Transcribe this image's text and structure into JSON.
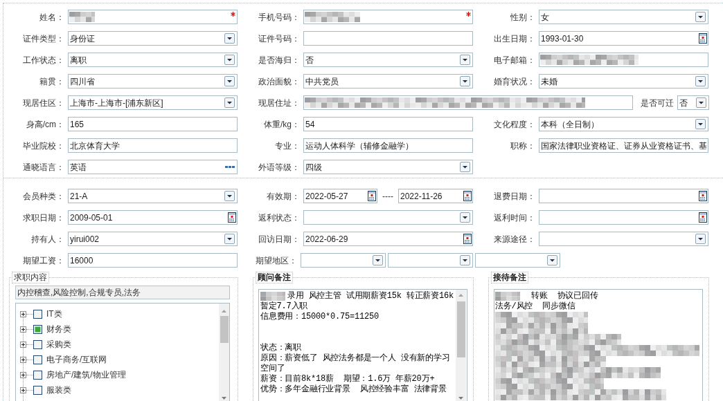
{
  "profile": {
    "rows": [
      [
        {
          "label": "姓名：",
          "kind": "text",
          "required": true,
          "redacted": true
        },
        {
          "label": "手机号码：",
          "kind": "text",
          "required": true,
          "redacted": true
        },
        {
          "label": "性别：",
          "kind": "select",
          "value": "女",
          "required": false,
          "redacted": false
        }
      ],
      [
        {
          "label": "证件类型：",
          "kind": "select",
          "value": "身份证",
          "required": false,
          "redacted": false
        },
        {
          "label": "证件号码：",
          "kind": "text",
          "required": false,
          "redacted": false
        },
        {
          "label": "出生日期：",
          "kind": "date",
          "value": "1993-01-30",
          "required": false,
          "redacted": false
        }
      ],
      [
        {
          "label": "工作状态：",
          "kind": "select",
          "value": "离职",
          "required": false,
          "redacted": false
        },
        {
          "label": "是否海归：",
          "kind": "select",
          "value": "否",
          "required": false,
          "redacted": false
        },
        {
          "label": "电子邮箱：",
          "kind": "text",
          "required": false,
          "redacted": true
        }
      ],
      [
        {
          "label": "籍贯：",
          "kind": "select",
          "value": "四川省",
          "required": false,
          "redacted": false
        },
        {
          "label": "政治面貌：",
          "kind": "select",
          "value": "中共党员",
          "required": false,
          "redacted": false
        },
        {
          "label": "婚育状况：",
          "kind": "select",
          "value": "未婚",
          "required": false,
          "redacted": false
        }
      ],
      [
        {
          "label": "现居住区：",
          "kind": "select",
          "value": "上海市-上海市-[浦东新区]",
          "required": false,
          "redacted": false
        },
        {
          "label": "现居住址：",
          "kind": "wide_text",
          "required": false,
          "redacted": true
        },
        {
          "label": "是否可迁",
          "kind": "compact_select",
          "value": "否",
          "required": false,
          "redacted": false
        }
      ],
      [
        {
          "label": "身高/cm：",
          "kind": "text",
          "value": "165",
          "required": false,
          "redacted": false
        },
        {
          "label": "体重/kg：",
          "kind": "text",
          "value": "54",
          "required": false,
          "redacted": false
        },
        {
          "label": "文化程度：",
          "kind": "select",
          "value": "本科（全日制）",
          "required": false,
          "redacted": false
        }
      ],
      [
        {
          "label": "毕业院校：",
          "kind": "text",
          "value": "北京体育大学",
          "required": false,
          "redacted": false
        },
        {
          "label": "专业：",
          "kind": "text",
          "value": "运动人体科学（辅修金融学）",
          "required": false,
          "redacted": false
        },
        {
          "label": "职称：",
          "kind": "text",
          "value": "国家法律职业资格证、证券从业资格证书、基",
          "required": false,
          "redacted": false
        }
      ],
      [
        {
          "label": "通晓语言：",
          "kind": "lookup",
          "value": "英语",
          "required": false,
          "redacted": false
        },
        {
          "label": "外语等级：",
          "kind": "select",
          "value": "四级",
          "required": false,
          "redacted": false
        }
      ]
    ]
  },
  "membership": {
    "rows": [
      [
        {
          "label": "会员种类：",
          "kind": "select",
          "value": "21-A",
          "required": false,
          "redacted": false
        },
        {
          "label": "有效期：",
          "kind": "date_range",
          "values": [
            "2022-05-27",
            "2022-11-26"
          ],
          "separator": "----",
          "required": false,
          "redacted": false
        },
        {
          "label": "退费日期：",
          "kind": "date",
          "required": false,
          "redacted": false
        }
      ],
      [
        {
          "label": "求职日期：",
          "kind": "date",
          "value": "2009-05-01",
          "required": false,
          "redacted": false
        },
        {
          "label": "返利状态：",
          "kind": "select",
          "required": false,
          "redacted": false
        },
        {
          "label": "返利时间：",
          "kind": "date",
          "required": false,
          "redacted": false
        }
      ],
      [
        {
          "label": "持有人：",
          "kind": "select",
          "value": "yirui002",
          "required": false,
          "redacted": false
        },
        {
          "label": "回访日期：",
          "kind": "date",
          "value": "2022-06-29",
          "required": false,
          "redacted": false
        },
        {
          "label": "来源途径：",
          "kind": "select",
          "required": false,
          "redacted": false
        }
      ],
      [
        {
          "label": "期望工资：",
          "kind": "text",
          "value": "16000",
          "required": false,
          "redacted": false
        },
        {
          "label": "期望地区：",
          "kind": "select_group",
          "selects": [
            {
              "kind": "select"
            },
            {
              "kind": "select"
            },
            {
              "kind": "select"
            }
          ],
          "required": false,
          "redacted": false
        }
      ]
    ]
  },
  "job_interest": {
    "legend": "求职内容",
    "selected_text": "内控稽查,风险控制,合规专员,法务",
    "tree": [
      {
        "label": "IT类",
        "expanded": false,
        "partial": false
      },
      {
        "label": "财务类",
        "expanded": false,
        "partial": true
      },
      {
        "label": "采购类",
        "expanded": false,
        "partial": false
      },
      {
        "label": "电子商务/互联网",
        "expanded": false,
        "partial": false
      },
      {
        "label": "房地产/建筑/物业管理",
        "expanded": false,
        "partial": false
      },
      {
        "label": "服装类",
        "expanded": false,
        "partial": false
      }
    ]
  },
  "advisor_notes": {
    "legend": "顾问备注",
    "paragraphs": [
      {
        "lines": [
          {
            "text": "录用 风控主管 试用期薪资15k 转正薪资16k",
            "redacted_prefix": true
          },
          {
            "text": "暂定7.7入职",
            "redacted_prefix": false
          },
          {
            "text": "信息费用：15000*0.75=11250",
            "redacted_prefix": false
          }
        ]
      },
      {
        "lines": [
          {
            "text": "状态：离职",
            "redacted_prefix": false
          },
          {
            "text": "原因：薪资低了 风控法务都是一个人 没有新的学习",
            "redacted_prefix": false
          },
          {
            "text": "空间了",
            "redacted_prefix": false
          },
          {
            "text": "薪资：目前8k*18薪  期望：1.6万 年薪20万+",
            "redacted_prefix": false
          },
          {
            "text": "优势：多年金融行业背景  风控经验丰富 法律背景",
            "redacted_prefix": false
          }
        ]
      }
    ]
  },
  "reception_notes": {
    "legend": "接待备注",
    "lines": [
      {
        "text": "转账  协议已回传",
        "redacted_prefix": true
      },
      {
        "text": "法务/风控  同步微信",
        "redacted_prefix": false
      }
    ],
    "redacted_block": true
  }
}
